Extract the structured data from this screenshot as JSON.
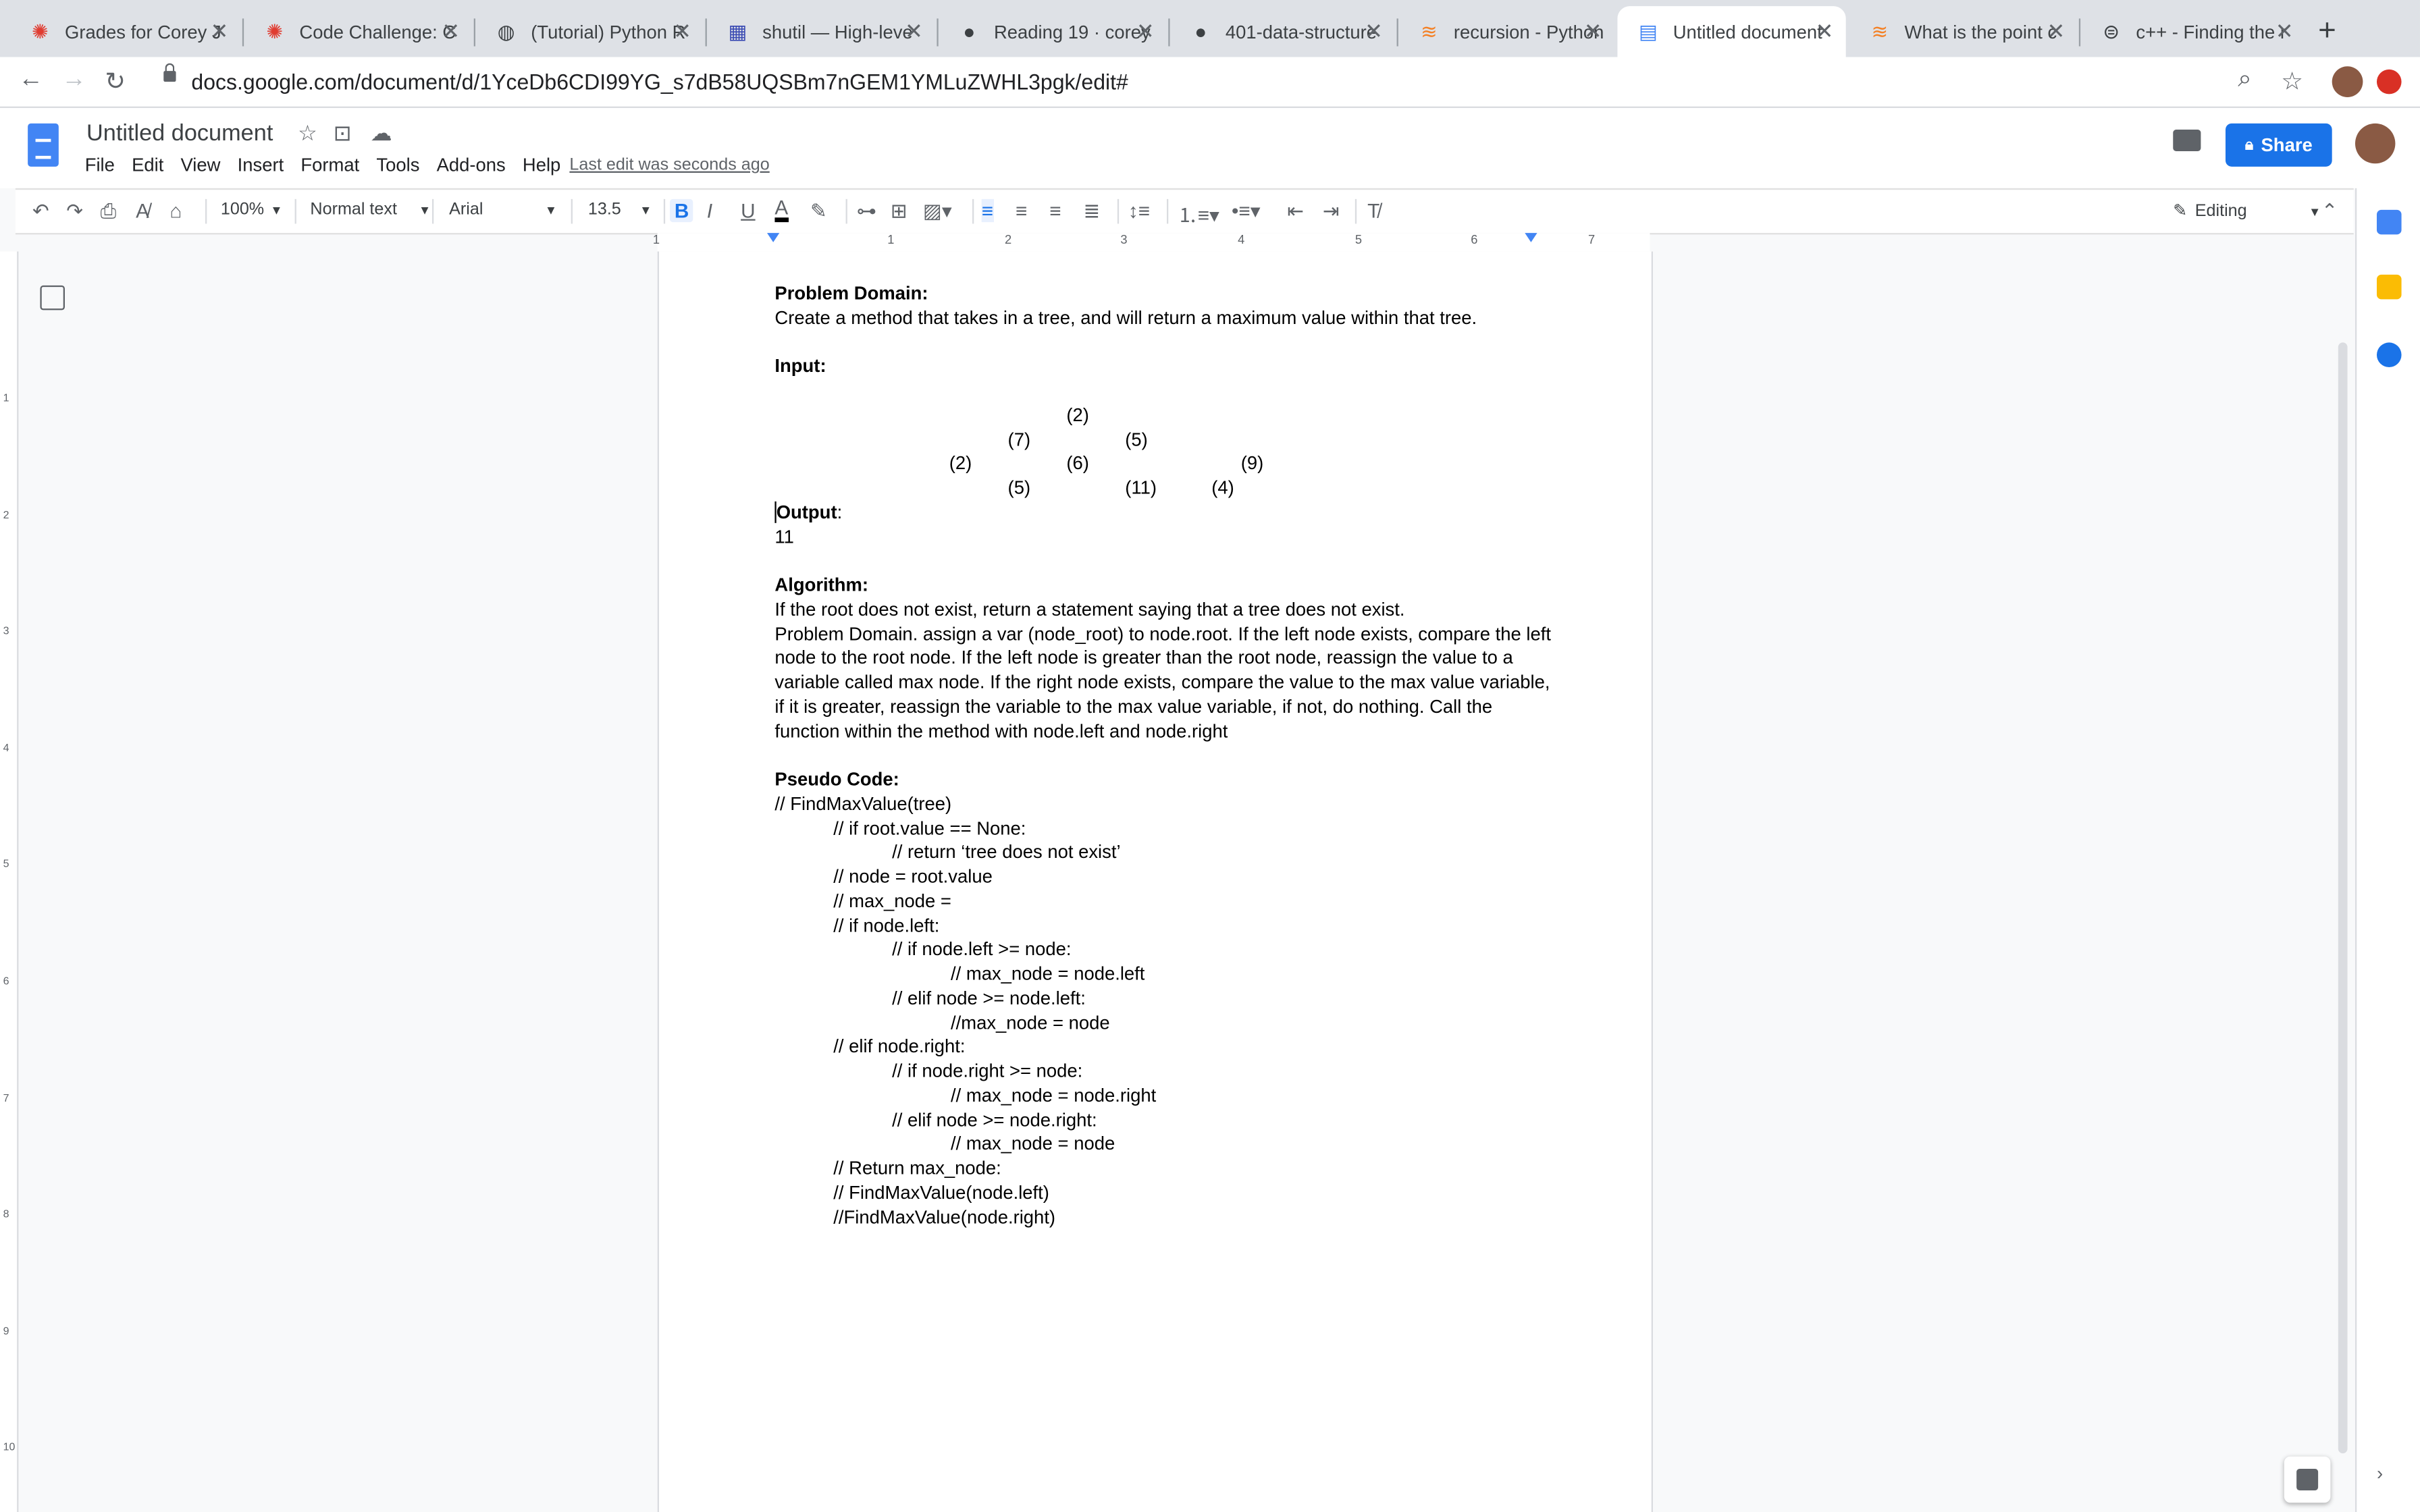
{
  "browser": {
    "tabs": [
      {
        "title": "Grades for Corey J",
        "icon": "canvas-icon"
      },
      {
        "title": "Code Challenge: C",
        "icon": "canvas-icon"
      },
      {
        "title": "(Tutorial) Python R",
        "icon": "globe-icon"
      },
      {
        "title": "shutil — High-leve",
        "icon": "python-docs-icon"
      },
      {
        "title": "Reading 19 · corey",
        "icon": "github-icon"
      },
      {
        "title": "401-data-structure",
        "icon": "github-icon"
      },
      {
        "title": "recursion - Python",
        "icon": "stackoverflow-icon"
      },
      {
        "title": "Untitled document",
        "icon": "docs-icon"
      },
      {
        "title": "What is the point c",
        "icon": "stackoverflow-icon"
      },
      {
        "title": "c++ - Finding the r",
        "icon": "search-icon"
      }
    ],
    "active_tab": 7,
    "url": "docs.google.com/document/d/1YceDb6CDI99YG_s7dB58UQSBm7nGEM1YMLuZWHL3pgk/edit#"
  },
  "docs": {
    "title": "Untitled document",
    "menu": [
      "File",
      "Edit",
      "View",
      "Insert",
      "Format",
      "Tools",
      "Add-ons",
      "Help"
    ],
    "last_edit": "Last edit was seconds ago",
    "share_label": "Share"
  },
  "toolbar": {
    "zoom": "100%",
    "style": "Normal text",
    "font": "Arial",
    "size": "13.5",
    "mode": "Editing"
  },
  "ruler": [
    "1",
    "1",
    "2",
    "3",
    "4",
    "5",
    "6",
    "7"
  ],
  "vruler": [
    "1",
    "2",
    "3",
    "4",
    "5",
    "6",
    "7",
    "8",
    "9",
    "10"
  ],
  "document": {
    "problem_heading": "Problem Domain:",
    "problem_text": "Create a method that takes in a tree, and will return a maximum value within that tree.",
    "input_heading": "Input:",
    "tree": {
      "row1": [
        "(2)"
      ],
      "row2": [
        "(7)",
        "(5)"
      ],
      "row3": [
        "(2)",
        "(6)",
        "(9)"
      ],
      "row4": [
        "(5)",
        "(11)",
        "(4)"
      ]
    },
    "output_heading": "Output",
    "output_colon": ":",
    "output_value": "11",
    "algorithm_heading": "Algorithm:",
    "algorithm_lines": [
      "If the root does not exist, return a statement saying that a tree does not exist.",
      "Problem Domain. assign a var (node_root) to node.root.  If the left node exists, compare the left",
      "node to the root node. If  the left node is greater than the root node, reassign the value to a",
      "variable called max node.  If the right node exists, compare the value to the max value variable,",
      "if it is greater, reassign the variable to the max value variable, if not, do nothing.  Call the",
      "function within the method with node.left and node.right"
    ],
    "pseudo_heading": "Pseudo Code:",
    "pseudo_lines": [
      {
        "indent": 0,
        "text": "// FindMaxValue(tree)"
      },
      {
        "indent": 1,
        "text": "// if root.value == None:"
      },
      {
        "indent": 2,
        "text": "// return ‘tree does not exist’"
      },
      {
        "indent": 1,
        "text": "// node = root.value"
      },
      {
        "indent": 1,
        "text": "// max_node ="
      },
      {
        "indent": 1,
        "text": "// if node.left:"
      },
      {
        "indent": 2,
        "text": "// if node.left >= node:"
      },
      {
        "indent": 3,
        "text": "// max_node = node.left"
      },
      {
        "indent": 2,
        "text": "// elif node >= node.left:"
      },
      {
        "indent": 3,
        "text": "//max_node = node"
      },
      {
        "indent": 1,
        "text": "// elif node.right:"
      },
      {
        "indent": 2,
        "text": "// if node.right >= node:"
      },
      {
        "indent": 3,
        "text": "// max_node = node.right"
      },
      {
        "indent": 2,
        "text": "// elif node >= node.right:"
      },
      {
        "indent": 3,
        "text": "// max_node = node"
      },
      {
        "indent": 1,
        "text": "// Return max_node:"
      },
      {
        "indent": 1,
        "text": "// FindMaxValue(node.left)"
      },
      {
        "indent": 1,
        "text": "//FindMaxValue(node.right)"
      }
    ]
  }
}
